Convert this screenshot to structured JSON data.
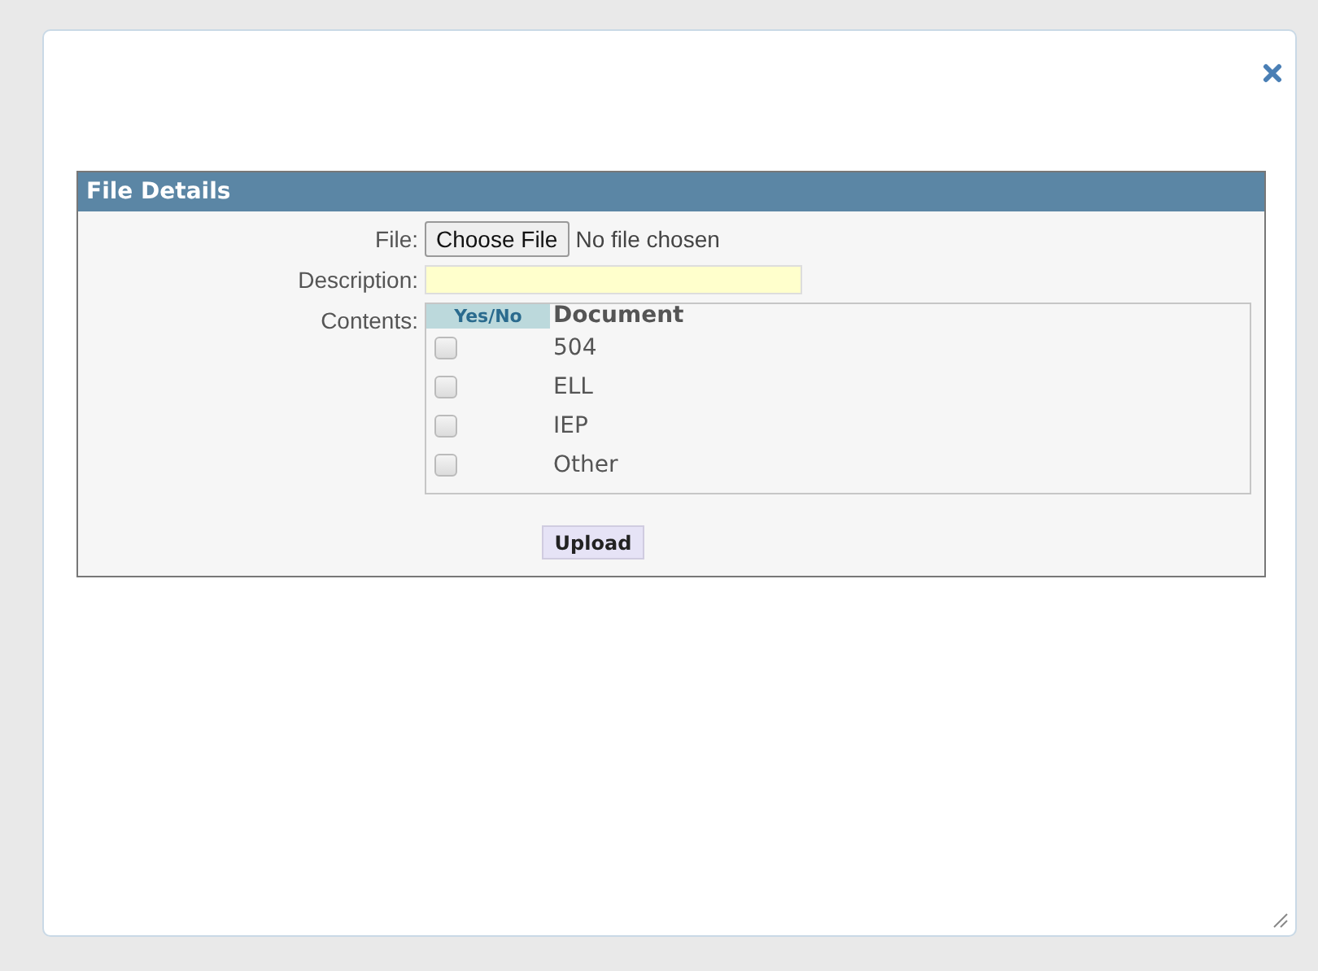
{
  "panel": {
    "title": "File Details"
  },
  "file": {
    "label": "File:",
    "button": "Choose File",
    "status": "No file chosen"
  },
  "description": {
    "label": "Description:"
  },
  "contents": {
    "label": "Contents:",
    "columns": [
      "Yes/No",
      "Document"
    ],
    "rows": [
      {
        "document": "504",
        "checked": false
      },
      {
        "document": "ELL",
        "checked": false
      },
      {
        "document": "IEP",
        "checked": false
      },
      {
        "document": "Other",
        "checked": false
      }
    ]
  },
  "upload_button": "Upload"
}
